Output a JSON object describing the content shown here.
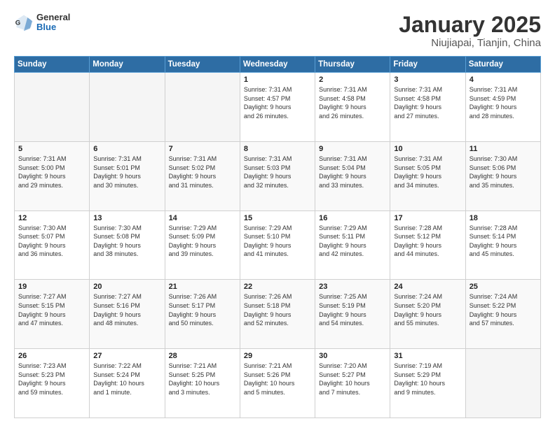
{
  "header": {
    "logo_general": "General",
    "logo_blue": "Blue",
    "title": "January 2025",
    "subtitle": "Niujiapai, Tianjin, China"
  },
  "weekdays": [
    "Sunday",
    "Monday",
    "Tuesday",
    "Wednesday",
    "Thursday",
    "Friday",
    "Saturday"
  ],
  "weeks": [
    [
      {
        "day": "",
        "info": ""
      },
      {
        "day": "",
        "info": ""
      },
      {
        "day": "",
        "info": ""
      },
      {
        "day": "1",
        "info": "Sunrise: 7:31 AM\nSunset: 4:57 PM\nDaylight: 9 hours\nand 26 minutes."
      },
      {
        "day": "2",
        "info": "Sunrise: 7:31 AM\nSunset: 4:58 PM\nDaylight: 9 hours\nand 26 minutes."
      },
      {
        "day": "3",
        "info": "Sunrise: 7:31 AM\nSunset: 4:58 PM\nDaylight: 9 hours\nand 27 minutes."
      },
      {
        "day": "4",
        "info": "Sunrise: 7:31 AM\nSunset: 4:59 PM\nDaylight: 9 hours\nand 28 minutes."
      }
    ],
    [
      {
        "day": "5",
        "info": "Sunrise: 7:31 AM\nSunset: 5:00 PM\nDaylight: 9 hours\nand 29 minutes."
      },
      {
        "day": "6",
        "info": "Sunrise: 7:31 AM\nSunset: 5:01 PM\nDaylight: 9 hours\nand 30 minutes."
      },
      {
        "day": "7",
        "info": "Sunrise: 7:31 AM\nSunset: 5:02 PM\nDaylight: 9 hours\nand 31 minutes."
      },
      {
        "day": "8",
        "info": "Sunrise: 7:31 AM\nSunset: 5:03 PM\nDaylight: 9 hours\nand 32 minutes."
      },
      {
        "day": "9",
        "info": "Sunrise: 7:31 AM\nSunset: 5:04 PM\nDaylight: 9 hours\nand 33 minutes."
      },
      {
        "day": "10",
        "info": "Sunrise: 7:31 AM\nSunset: 5:05 PM\nDaylight: 9 hours\nand 34 minutes."
      },
      {
        "day": "11",
        "info": "Sunrise: 7:30 AM\nSunset: 5:06 PM\nDaylight: 9 hours\nand 35 minutes."
      }
    ],
    [
      {
        "day": "12",
        "info": "Sunrise: 7:30 AM\nSunset: 5:07 PM\nDaylight: 9 hours\nand 36 minutes."
      },
      {
        "day": "13",
        "info": "Sunrise: 7:30 AM\nSunset: 5:08 PM\nDaylight: 9 hours\nand 38 minutes."
      },
      {
        "day": "14",
        "info": "Sunrise: 7:29 AM\nSunset: 5:09 PM\nDaylight: 9 hours\nand 39 minutes."
      },
      {
        "day": "15",
        "info": "Sunrise: 7:29 AM\nSunset: 5:10 PM\nDaylight: 9 hours\nand 41 minutes."
      },
      {
        "day": "16",
        "info": "Sunrise: 7:29 AM\nSunset: 5:11 PM\nDaylight: 9 hours\nand 42 minutes."
      },
      {
        "day": "17",
        "info": "Sunrise: 7:28 AM\nSunset: 5:12 PM\nDaylight: 9 hours\nand 44 minutes."
      },
      {
        "day": "18",
        "info": "Sunrise: 7:28 AM\nSunset: 5:14 PM\nDaylight: 9 hours\nand 45 minutes."
      }
    ],
    [
      {
        "day": "19",
        "info": "Sunrise: 7:27 AM\nSunset: 5:15 PM\nDaylight: 9 hours\nand 47 minutes."
      },
      {
        "day": "20",
        "info": "Sunrise: 7:27 AM\nSunset: 5:16 PM\nDaylight: 9 hours\nand 48 minutes."
      },
      {
        "day": "21",
        "info": "Sunrise: 7:26 AM\nSunset: 5:17 PM\nDaylight: 9 hours\nand 50 minutes."
      },
      {
        "day": "22",
        "info": "Sunrise: 7:26 AM\nSunset: 5:18 PM\nDaylight: 9 hours\nand 52 minutes."
      },
      {
        "day": "23",
        "info": "Sunrise: 7:25 AM\nSunset: 5:19 PM\nDaylight: 9 hours\nand 54 minutes."
      },
      {
        "day": "24",
        "info": "Sunrise: 7:24 AM\nSunset: 5:20 PM\nDaylight: 9 hours\nand 55 minutes."
      },
      {
        "day": "25",
        "info": "Sunrise: 7:24 AM\nSunset: 5:22 PM\nDaylight: 9 hours\nand 57 minutes."
      }
    ],
    [
      {
        "day": "26",
        "info": "Sunrise: 7:23 AM\nSunset: 5:23 PM\nDaylight: 9 hours\nand 59 minutes."
      },
      {
        "day": "27",
        "info": "Sunrise: 7:22 AM\nSunset: 5:24 PM\nDaylight: 10 hours\nand 1 minute."
      },
      {
        "day": "28",
        "info": "Sunrise: 7:21 AM\nSunset: 5:25 PM\nDaylight: 10 hours\nand 3 minutes."
      },
      {
        "day": "29",
        "info": "Sunrise: 7:21 AM\nSunset: 5:26 PM\nDaylight: 10 hours\nand 5 minutes."
      },
      {
        "day": "30",
        "info": "Sunrise: 7:20 AM\nSunset: 5:27 PM\nDaylight: 10 hours\nand 7 minutes."
      },
      {
        "day": "31",
        "info": "Sunrise: 7:19 AM\nSunset: 5:29 PM\nDaylight: 10 hours\nand 9 minutes."
      },
      {
        "day": "",
        "info": ""
      }
    ]
  ]
}
